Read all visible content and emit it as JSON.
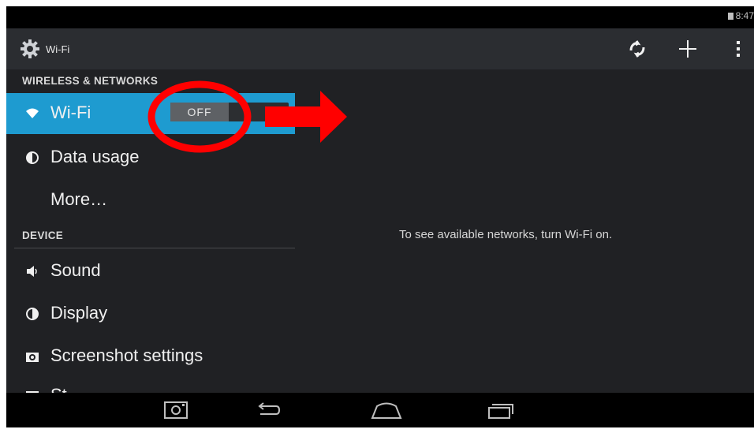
{
  "status_bar": {
    "time": "8:47"
  },
  "action_bar": {
    "title": "Wi-Fi",
    "icons": [
      "settings-gear-icon",
      "wps-icon",
      "add-icon",
      "overflow-menu-icon"
    ]
  },
  "settings_list": {
    "sections": [
      {
        "header": "WIRELESS & NETWORKS"
      },
      {
        "header": "DEVICE"
      }
    ],
    "items": [
      {
        "label": "Wi-Fi",
        "icon": "wifi-icon",
        "selected": true
      },
      {
        "label": "Data usage",
        "icon": "data-usage-icon"
      },
      {
        "label": "More…",
        "icon": ""
      },
      {
        "label": "Sound",
        "icon": "sound-icon"
      },
      {
        "label": "Display",
        "icon": "display-icon"
      },
      {
        "label": "Screenshot settings",
        "icon": "camera-icon"
      },
      {
        "label": "St",
        "icon": "storage-icon"
      }
    ],
    "wifi_toggle": {
      "state": "OFF"
    }
  },
  "detail_pane": {
    "message": "To see available networks, turn Wi-Fi on."
  },
  "nav_bar": {
    "icons": [
      "screenshot-icon",
      "back-icon",
      "home-icon",
      "recents-icon"
    ]
  },
  "colors": {
    "background": "#202124",
    "action_bar": "#2b2d31",
    "selected_item": "#1e9bd0",
    "annotation_red": "#ff0000"
  }
}
